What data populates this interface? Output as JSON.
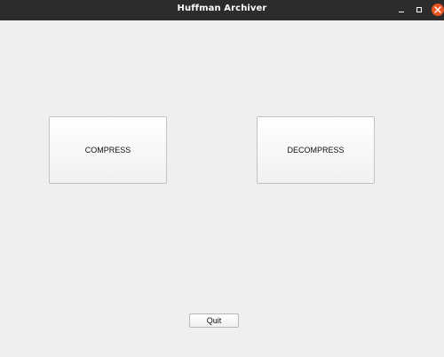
{
  "window": {
    "title": "Huffman Archiver",
    "controls": {
      "minimize_icon": "minimize-icon",
      "maximize_icon": "maximize-icon",
      "close_icon": "close-icon"
    }
  },
  "main": {
    "compress_label": "COMPRESS",
    "decompress_label": "DECOMPRESS",
    "quit_label": "Quit"
  },
  "colors": {
    "titlebar": "#2c2c2c",
    "close_button": "#e95420",
    "background": "#efefef"
  }
}
